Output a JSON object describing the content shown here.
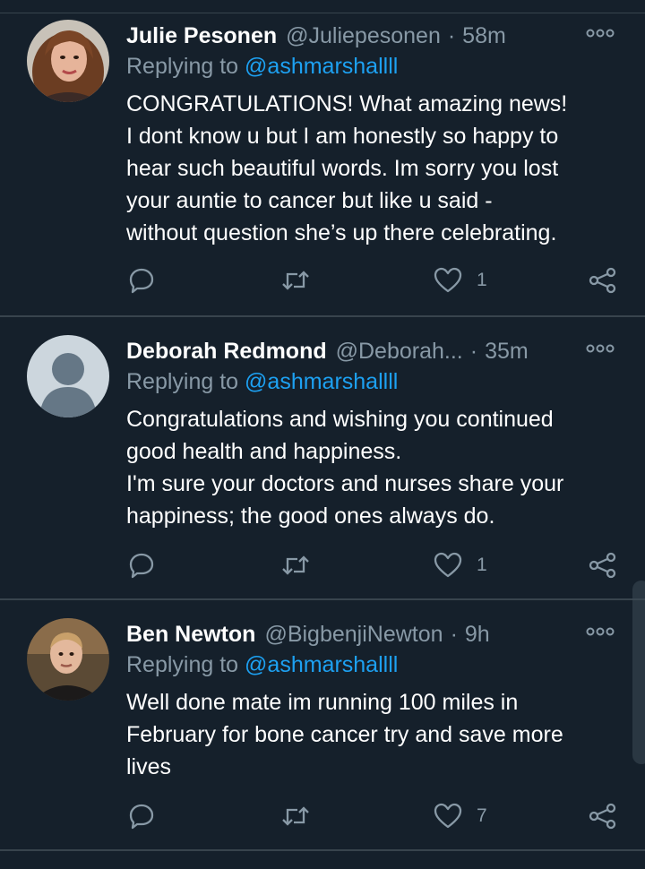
{
  "colors": {
    "background": "#15202b",
    "divider": "#38444d",
    "text_primary": "#ffffff",
    "text_secondary": "#8899a6",
    "link": "#1da1f2"
  },
  "replying_prefix": "Replying to",
  "tweets": [
    {
      "name": "Julie Pesonen",
      "handle": "@Juliepesonen",
      "separator": "·",
      "time": "58m",
      "reply_to": "@ashmarshallll",
      "lines": [
        "CONGRATULATIONS!  What amazing news!",
        "I dont know u but I am honestly so happy to",
        "hear such beautiful words.  Im sorry you lost",
        "your auntie to cancer but like u said -",
        "without question she’s up there celebrating."
      ],
      "likes": "1",
      "icons": [
        "more-icon",
        "reply-icon",
        "retweet-icon",
        "like-icon",
        "share-icon"
      ]
    },
    {
      "name": "Deborah Redmond",
      "handle": "@Deborah...",
      "separator": "·",
      "time": "35m",
      "reply_to": "@ashmarshallll",
      "lines": [
        "Congratulations and wishing you continued",
        "good health and happiness.",
        "I'm sure your doctors and nurses share your",
        "happiness; the good ones always do."
      ],
      "likes": "1",
      "icons": [
        "more-icon",
        "reply-icon",
        "retweet-icon",
        "like-icon",
        "share-icon"
      ]
    },
    {
      "name": "Ben Newton",
      "handle": "@BigbenjiNewton",
      "separator": "·",
      "time": "9h",
      "reply_to": "@ashmarshallll",
      "lines": [
        "Well done mate im running 100 miles in",
        "February for bone cancer try and save more",
        "lives"
      ],
      "likes": "7",
      "icons": [
        "more-icon",
        "reply-icon",
        "retweet-icon",
        "like-icon",
        "share-icon"
      ]
    }
  ]
}
